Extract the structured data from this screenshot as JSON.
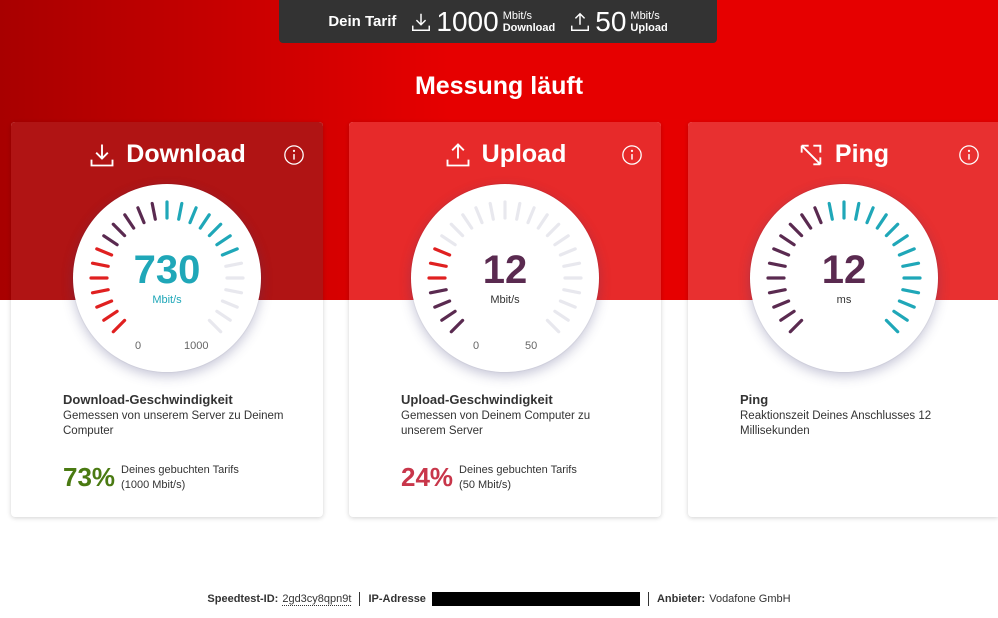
{
  "tariff": {
    "label": "Dein Tarif",
    "download_value": "1000",
    "download_unit": "Mbit/s",
    "download_label": "Download",
    "upload_value": "50",
    "upload_unit": "Mbit/s",
    "upload_label": "Upload"
  },
  "title": "Messung läuft",
  "cards": {
    "download": {
      "heading": "Download",
      "value": "730",
      "unit": "Mbit/s",
      "scale_min": "0",
      "scale_max": "1000",
      "title": "Download-Geschwindigkeit",
      "desc": "Gemessen von unserem Server zu Deinem Computer",
      "pct": "73%",
      "pct_desc_line1": "Deines gebuchten Tarifs",
      "pct_desc_line2": "(1000 Mbit/s)",
      "fraction": 0.73
    },
    "upload": {
      "heading": "Upload",
      "value": "12",
      "unit": "Mbit/s",
      "scale_min": "0",
      "scale_max": "50",
      "title": "Upload-Geschwindigkeit",
      "desc": "Gemessen von Deinem Computer zu unserem Server",
      "pct": "24%",
      "pct_desc_line1": "Deines gebuchten Tarifs",
      "pct_desc_line2": "(50 Mbit/s)",
      "fraction": 0.24
    },
    "ping": {
      "heading": "Ping",
      "value": "12",
      "unit": "ms",
      "title": "Ping",
      "desc": "Reaktionszeit Deines Anschlusses 12 Millisekunden",
      "fraction": 1.0
    }
  },
  "footer": {
    "speedtest_label": "Speedtest-ID:",
    "speedtest_id": "2gd3cy8qpn9t",
    "ip_label": "IP-Adresse",
    "provider_label": "Anbieter:",
    "provider": "Vodafone GmbH"
  },
  "colors": {
    "brand_red": "#e60000",
    "dark_red": "#a80000",
    "teal": "#1fa7b8",
    "plum": "#5a2a50",
    "pct_green": "#4a7a12",
    "pct_red": "#c8364a",
    "tick_red": "#e02020"
  },
  "icons": [
    "download-icon",
    "upload-icon",
    "ping-icon",
    "info-icon"
  ]
}
